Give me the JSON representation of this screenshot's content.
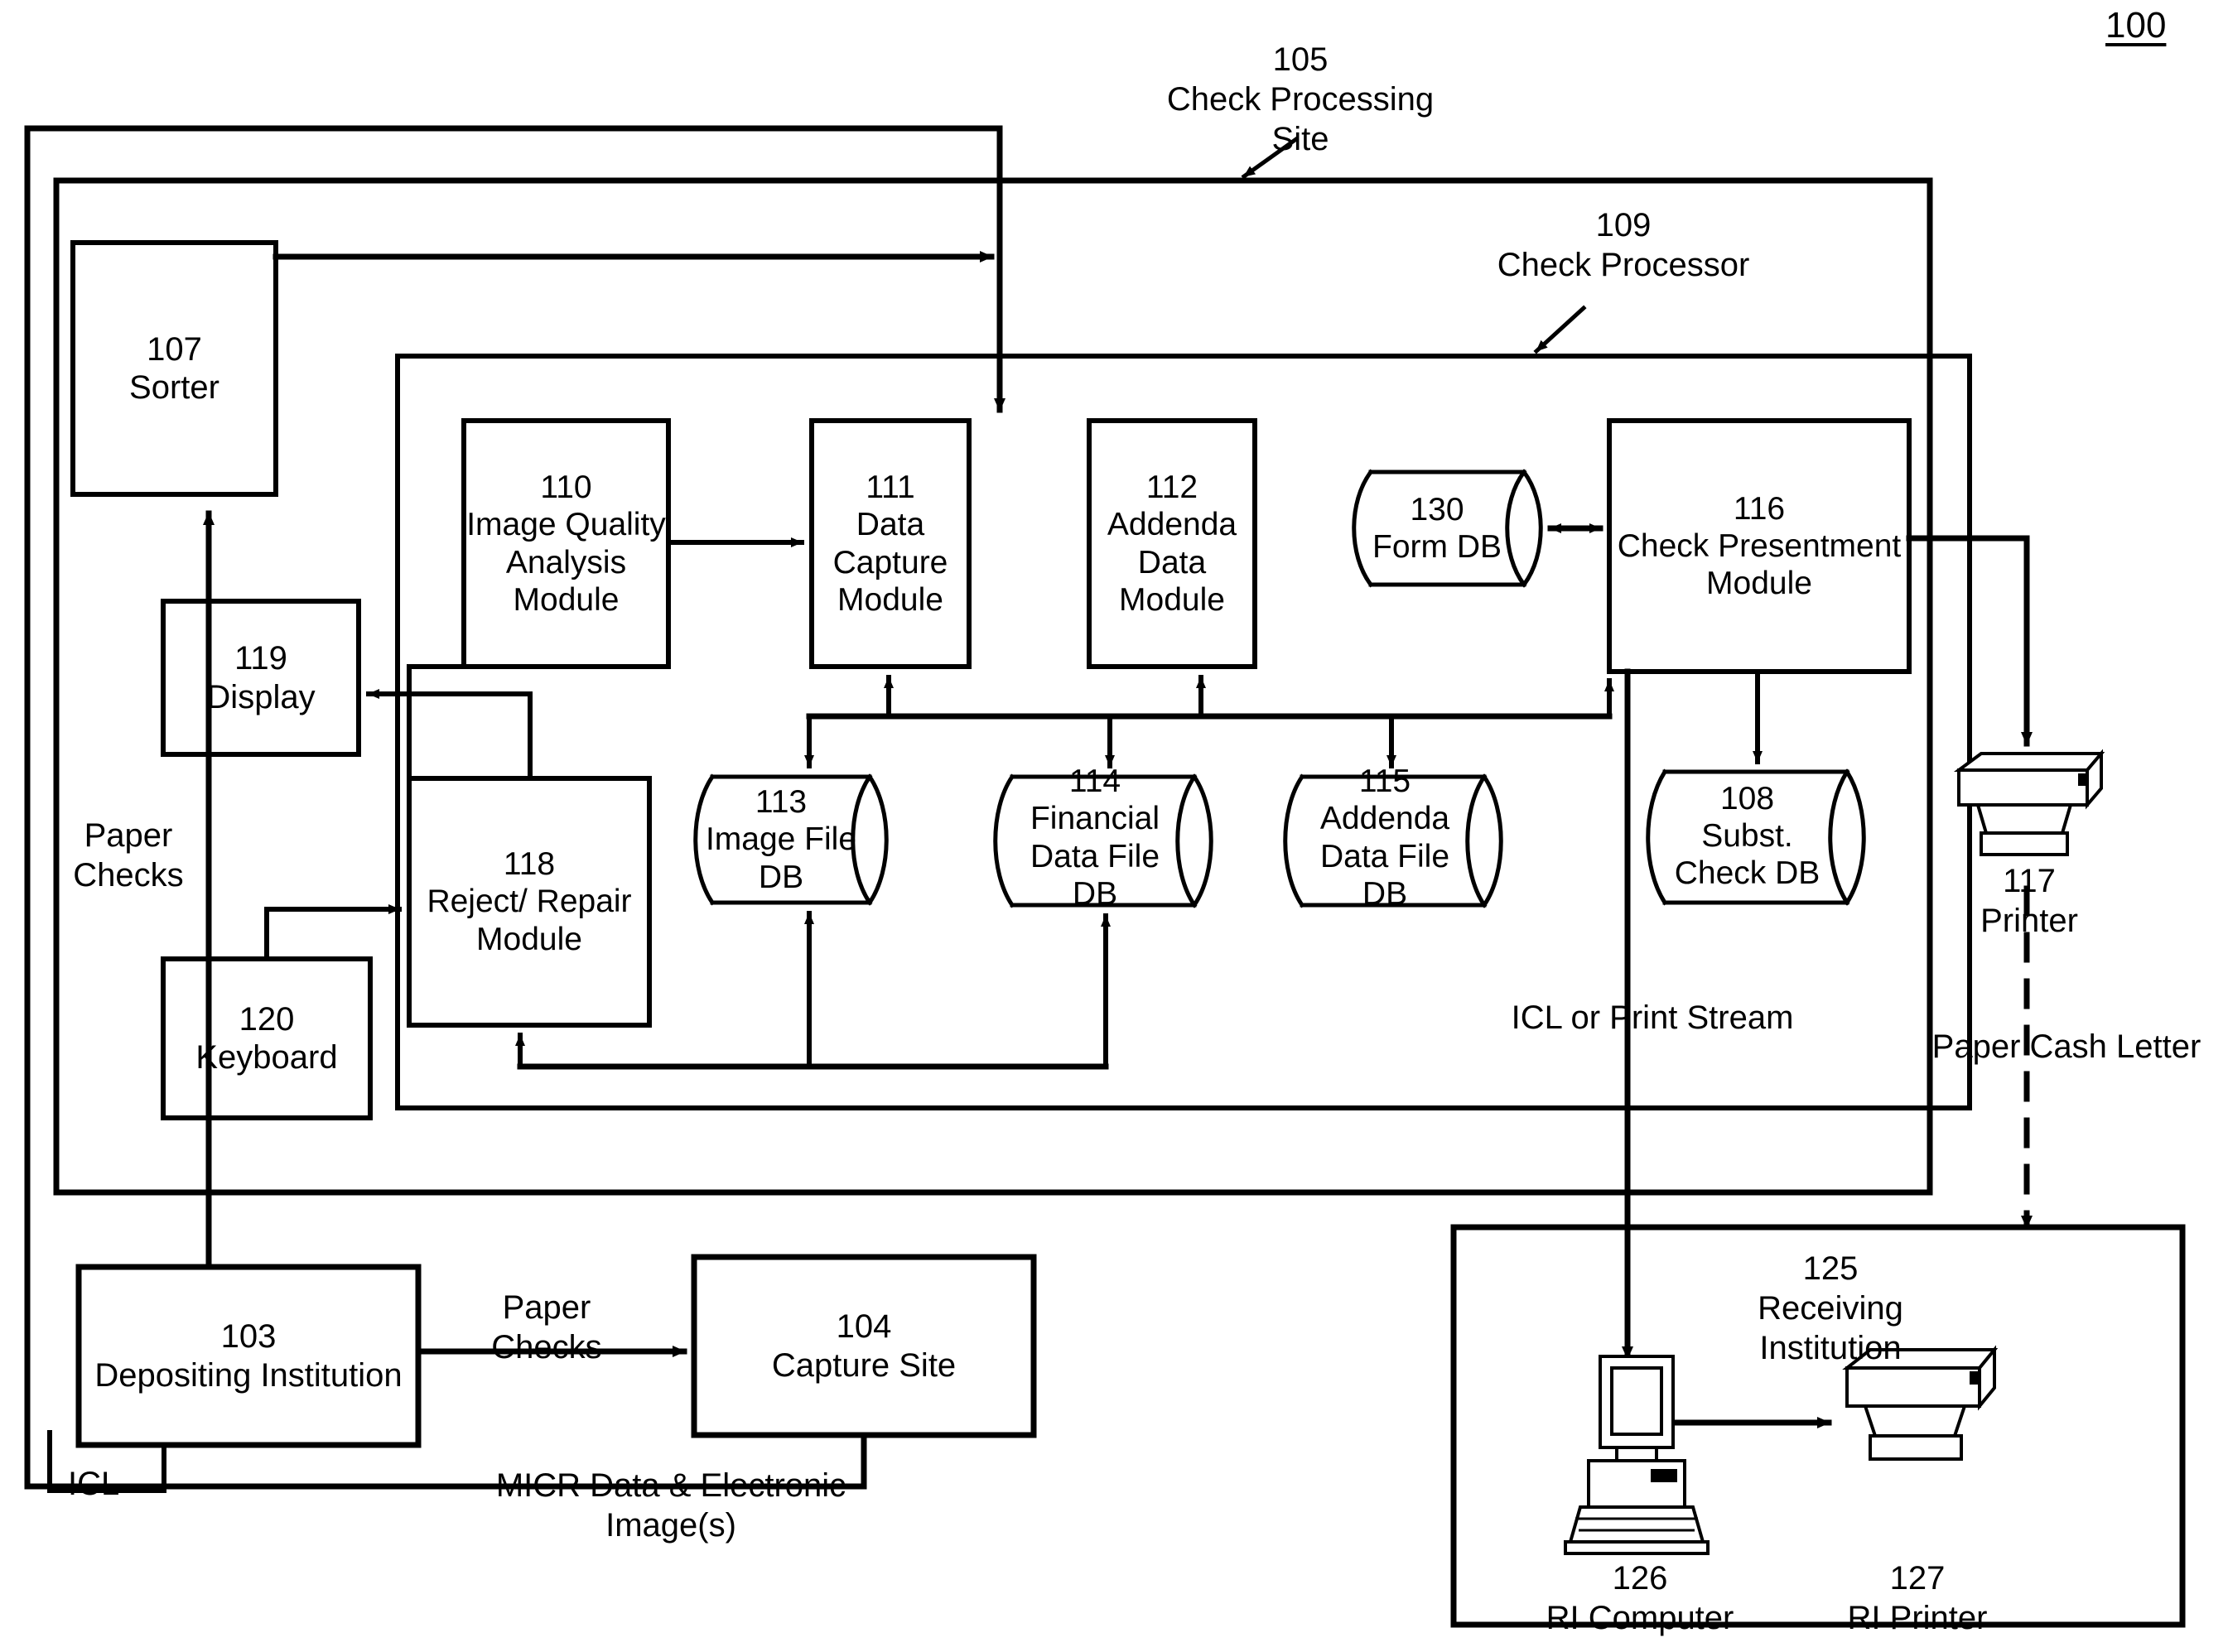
{
  "figure": {
    "number": "100"
  },
  "callouts": [
    {
      "id": "105",
      "number": "105",
      "label": "Check Processing Site"
    },
    {
      "id": "109",
      "number": "109",
      "label": "Check Processor"
    }
  ],
  "boxes": [
    {
      "id": "107",
      "number": "107",
      "label": "Sorter"
    },
    {
      "id": "110",
      "number": "110",
      "label": "Image Quality\nAnalysis\nModule"
    },
    {
      "id": "111",
      "number": "111",
      "label": "Data\nCapture\nModule"
    },
    {
      "id": "112",
      "number": "112",
      "label": "Addenda\nData\nModule"
    },
    {
      "id": "116",
      "number": "116",
      "label": "Check\nPresentment\nModule"
    },
    {
      "id": "119",
      "number": "119",
      "label": "Display"
    },
    {
      "id": "118",
      "number": "118",
      "label": "Reject/\nRepair\nModule"
    },
    {
      "id": "120",
      "number": "120",
      "label": "Keyboard"
    },
    {
      "id": "103",
      "number": "103",
      "label": "Depositing\nInstitution"
    },
    {
      "id": "104",
      "number": "104",
      "label": "Capture Site"
    }
  ],
  "databases": [
    {
      "id": "130",
      "number": "130",
      "label": "Form\nDB"
    },
    {
      "id": "113",
      "number": "113",
      "label": "Image\nFile DB"
    },
    {
      "id": "114",
      "number": "114",
      "label": "Financial\nData File\nDB"
    },
    {
      "id": "115",
      "number": "115",
      "label": "Addenda\nData File\nDB"
    },
    {
      "id": "108",
      "number": "108",
      "label": "Subst.\nCheck\nDB"
    }
  ],
  "devices": [
    {
      "id": "117",
      "number": "117",
      "label": "Printer",
      "icon": "printer-icon"
    },
    {
      "id": "126",
      "number": "126",
      "label": "RI Computer",
      "icon": "computer-icon"
    },
    {
      "id": "127",
      "number": "127",
      "label": "RI Printer",
      "icon": "printer-icon"
    }
  ],
  "group": {
    "id": "125",
    "number": "125",
    "label": "Receiving\nInstitution"
  },
  "edge_labels": [
    {
      "id": "paper-checks-left",
      "text": "Paper\nChecks"
    },
    {
      "id": "paper-checks-bottom",
      "text": "Paper\nChecks"
    },
    {
      "id": "icl",
      "text": "ICL"
    },
    {
      "id": "micr",
      "text": "MICR Data &\nElectronic Image(s)"
    },
    {
      "id": "icl-or-print-stream",
      "text": "ICL or\nPrint Stream"
    },
    {
      "id": "paper-cash-letter",
      "text": "Paper\nCash Letter"
    }
  ],
  "colors": {
    "ink": "#000000",
    "paper": "#ffffff"
  }
}
